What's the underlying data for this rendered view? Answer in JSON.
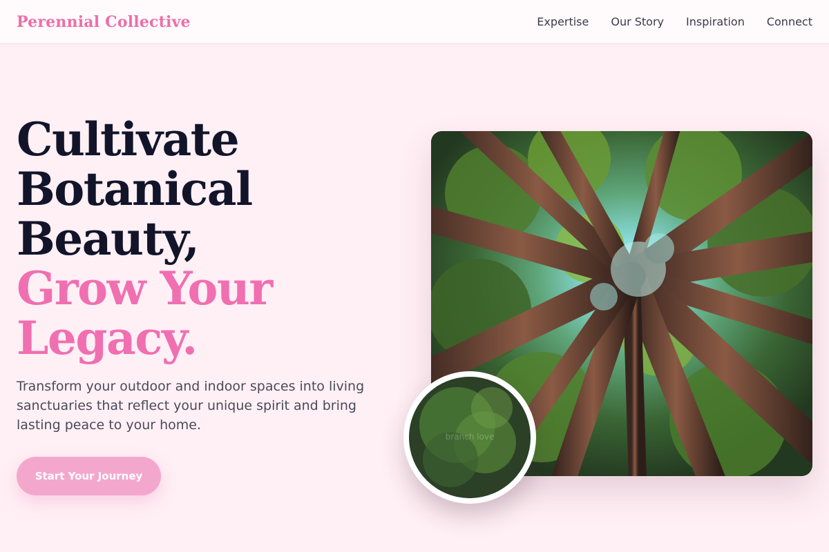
{
  "header": {
    "brand": "Perennial Collective",
    "nav": [
      "Expertise",
      "Our Story",
      "Inspiration",
      "Connect"
    ]
  },
  "hero": {
    "title_lines": [
      "Cultivate",
      "Botanical",
      "Beauty,"
    ],
    "title_accent_lines": [
      "Grow Your",
      "Legacy."
    ],
    "subtitle": "Transform your outdoor and indoor spaces into living sanctuaries that reflect your unique spirit and bring lasting peace to your home.",
    "cta_label": "Start Your Journey"
  },
  "inset": {
    "caption": "branch love"
  },
  "colors": {
    "brand": "#ec6fa9",
    "accent_text": "#f06fb1",
    "cta_bg": "#f4a7cd",
    "page_bg": "#fff0f5",
    "heading": "#12152a"
  }
}
